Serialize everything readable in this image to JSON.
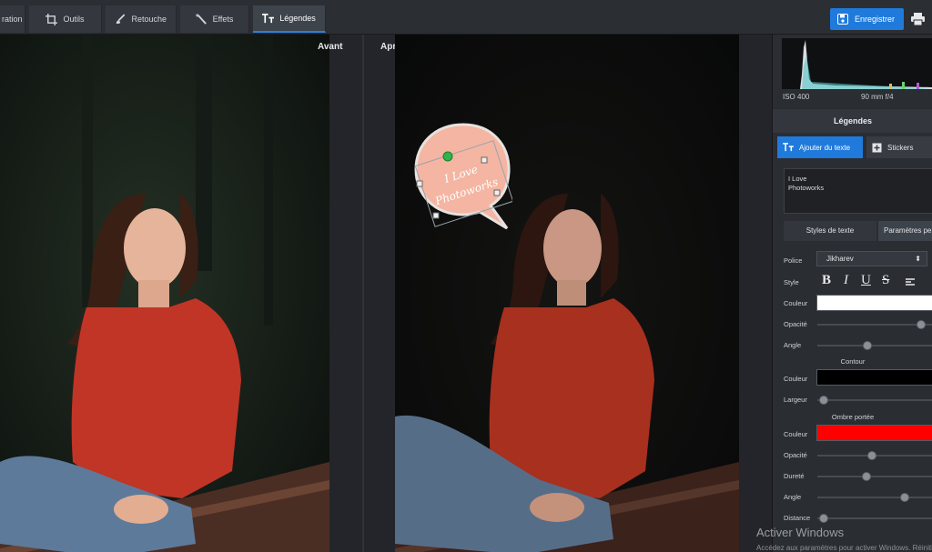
{
  "toolbar": {
    "tabs": [
      {
        "label": "ration",
        "icon": "enhance-icon"
      },
      {
        "label": "Outils",
        "icon": "crop-icon"
      },
      {
        "label": "Retouche",
        "icon": "brush-icon"
      },
      {
        "label": "Effets",
        "icon": "magic-wand-icon"
      },
      {
        "label": "Légendes",
        "icon": "text-icon",
        "active": true
      }
    ],
    "save_label": "Enregistrer",
    "accent": "#1f7adb"
  },
  "canvas": {
    "before_label": "Avant",
    "after_label": "Après",
    "sticker": {
      "line1": "I Love",
      "line2": "Photoworks",
      "fill": "#f4b5a2"
    }
  },
  "panel": {
    "histogram_info": {
      "iso": "ISO 400",
      "lens": "90 mm f/4"
    },
    "section_title": "Légendes",
    "add_text_label": "Ajouter du texte",
    "stickers_label": "Stickers",
    "text_content": "I Love\nPhotoworks",
    "subtabs": {
      "styles": "Styles de texte",
      "params": "Paramètres per"
    },
    "font_label": "Police",
    "font_value": "Jikharev",
    "style_label": "Style",
    "style_buttons": {
      "bold": "B",
      "italic": "I",
      "underline": "U",
      "strike": "S"
    },
    "text_color_label": "Couleur",
    "text_color": "#ffffff",
    "opacity_label": "Opacité",
    "opacity_value": 0.93,
    "angle_label": "Angle",
    "angle_value": 0.43,
    "outline_title": "Contour",
    "outline_color_label": "Couleur",
    "outline_color": "#000000",
    "outline_width_label": "Largeur",
    "outline_width_value": 0.02,
    "shadow_title": "Ombre portée",
    "shadow_color_label": "Couleur",
    "shadow_color": "#ff0000",
    "shadow_opacity_label": "Opacité",
    "shadow_opacity_value": 0.47,
    "shadow_hardness_label": "Dureté",
    "shadow_hardness_value": 0.42,
    "shadow_angle_label": "Angle",
    "shadow_angle_value": 0.78,
    "shadow_distance_label": "Distance",
    "shadow_distance_value": 0.02
  },
  "watermark": {
    "title": "Activer Windows",
    "subtitle": "Accédez aux paramètres pour activer Windows.   Réinitialiser tout"
  }
}
